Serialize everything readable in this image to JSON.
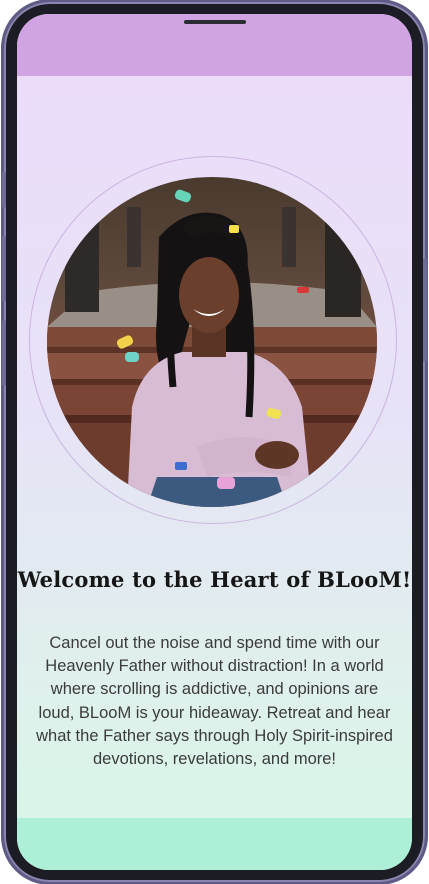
{
  "welcome": {
    "headline": "Welcome to the Heart of BLooM!",
    "body": "Cancel out the noise and spend time with our Heavenly Father without distraction! In a world where scrolling is addictive, and opinions are loud, BLooM is your hideaway. Retreat and hear what the Father says through Holy Spirit-inspired devotions, revelations, and more!"
  },
  "colors": {
    "top_band": "#d0a3e3",
    "bottom_band": "#aeefd8",
    "frame": "#1c1c24"
  }
}
